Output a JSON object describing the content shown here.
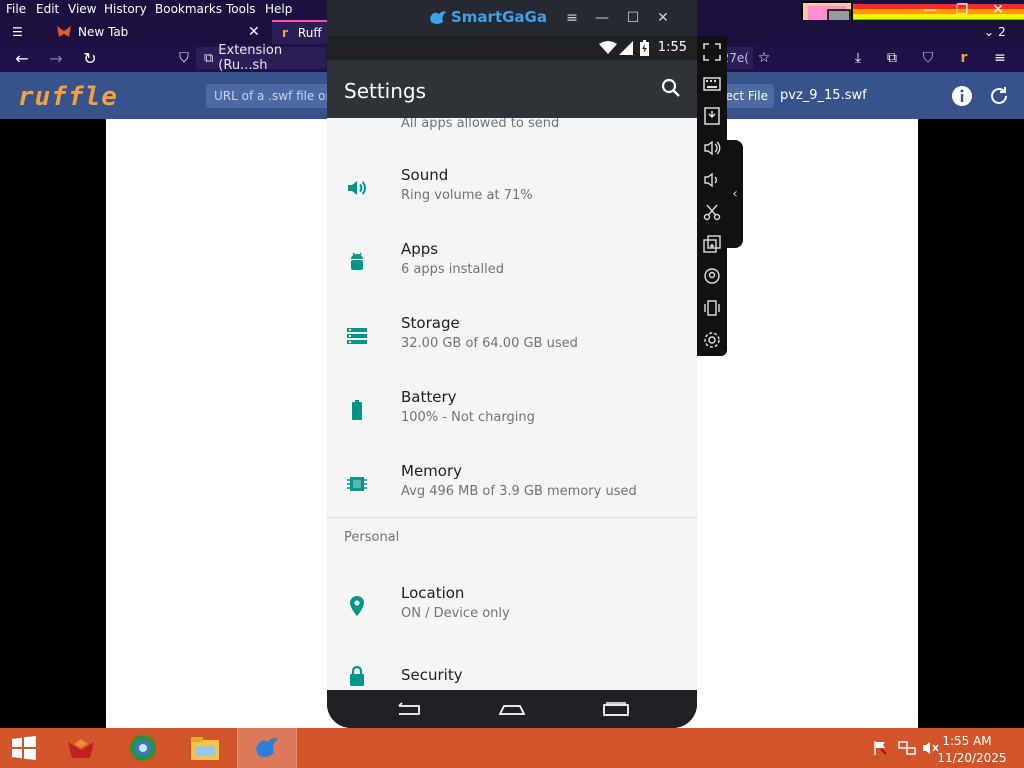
{
  "menu": {
    "file": "File",
    "edit": "Edit",
    "view": "View",
    "history": "History",
    "bookmarks": "Bookmarks",
    "tools": "Tools",
    "help": "Help"
  },
  "tabs": [
    {
      "label": "New Tab"
    },
    {
      "label": "Ruff"
    }
  ],
  "tab_count": "2",
  "url": {
    "text": "Extension (Ru...sh",
    "partial_right": "27e("
  },
  "ruffle": {
    "logo": "ruffle",
    "url_placeholder": "URL of a .swf file or",
    "select_file": "ect File",
    "file_name": "pvz_9_15.swf"
  },
  "emulator": {
    "brand": "SmartGaGa",
    "clock": "1:55",
    "title": "Settings",
    "partial_row_sub": "All apps allowed to send",
    "rows": [
      {
        "title": "Sound",
        "sub": "Ring volume at 71%",
        "icon": "volume-icon"
      },
      {
        "title": "Apps",
        "sub": "6 apps installed",
        "icon": "android-icon"
      },
      {
        "title": "Storage",
        "sub": "32.00 GB of 64.00 GB used",
        "icon": "storage-icon"
      },
      {
        "title": "Battery",
        "sub": "100% - Not charging",
        "icon": "battery-icon"
      },
      {
        "title": "Memory",
        "sub": "Avg 496 MB of 3.9 GB memory used",
        "icon": "memory-chip-icon"
      }
    ],
    "section_personal": "Personal",
    "personal_rows": [
      {
        "title": "Location",
        "sub": "ON / Device only",
        "icon": "location-pin-icon"
      },
      {
        "title": "Security",
        "sub": "",
        "icon": "lock-icon"
      }
    ]
  },
  "taskbar": {
    "time": "1:55 AM",
    "date": "11/20/2025"
  },
  "colors": {
    "teal": "#009688",
    "accent_blue": "#3ea1ee",
    "taskbar": "#d2542b",
    "ruffle_header": "#37528c"
  }
}
